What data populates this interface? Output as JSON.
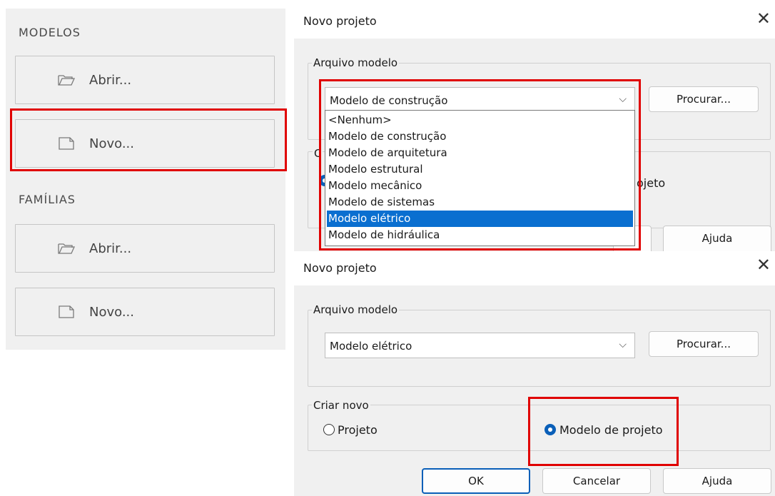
{
  "left_panel": {
    "modelos_title": "MODELOS",
    "familias_title": "FAMÍLIAS",
    "abrir_label": "Abrir...",
    "novo_label": "Novo..."
  },
  "dialog_top": {
    "title": "Novo projeto",
    "close_glyph": "✕",
    "group_arquivo": "Arquivo modelo",
    "combo_value": "Modelo de construção",
    "chevron": "⌵",
    "procurar": "Procurar...",
    "partial_group_char": "C",
    "partial_radio_text": "ojeto",
    "ajuda": "Ajuda",
    "dropdown_options": [
      "<Nenhum>",
      "Modelo de construção",
      "Modelo de arquitetura",
      "Modelo estrutural",
      "Modelo mecânico",
      "Modelo de sistemas",
      "Modelo elétrico",
      "Modelo de hidráulica"
    ],
    "selected_option": "Modelo elétrico"
  },
  "dialog_bottom": {
    "title": "Novo projeto",
    "close_glyph": "✕",
    "group_arquivo": "Arquivo modelo",
    "combo_value": "Modelo elétrico",
    "chevron": "⌵",
    "procurar": "Procurar...",
    "group_criar": "Criar novo",
    "radio_projeto": "Projeto",
    "radio_modelo": "Modelo de projeto",
    "selected_radio": "Modelo de projeto",
    "ok": "OK",
    "cancelar": "Cancelar",
    "ajuda": "Ajuda"
  },
  "colors": {
    "highlight": "#e00000",
    "selection": "#0a6fd0",
    "panel_bg": "#f0f0f0"
  }
}
